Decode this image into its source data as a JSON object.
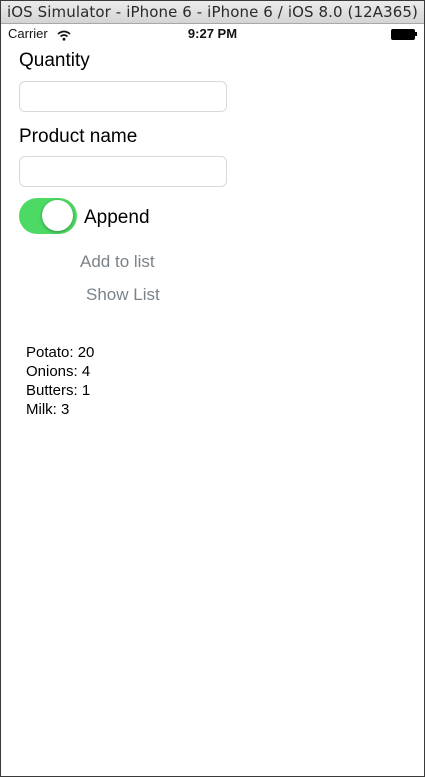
{
  "window": {
    "title": "iOS Simulator - iPhone 6 - iPhone 6 / iOS 8.0 (12A365)"
  },
  "status_bar": {
    "carrier": "Carrier",
    "time": "9:27 PM",
    "wifi_icon": "wifi-icon",
    "battery_icon": "battery-icon"
  },
  "form": {
    "quantity_label": "Quantity",
    "quantity_value": "",
    "product_label": "Product name",
    "product_value": "",
    "append_label": "Append",
    "append_on": true,
    "switch_color": "#4cd964"
  },
  "actions": {
    "add_label": "Add to list",
    "show_label": "Show List"
  },
  "list": {
    "items": [
      "Potato: 20",
      "Onions: 4",
      "Butters: 1",
      "Milk: 3"
    ]
  }
}
